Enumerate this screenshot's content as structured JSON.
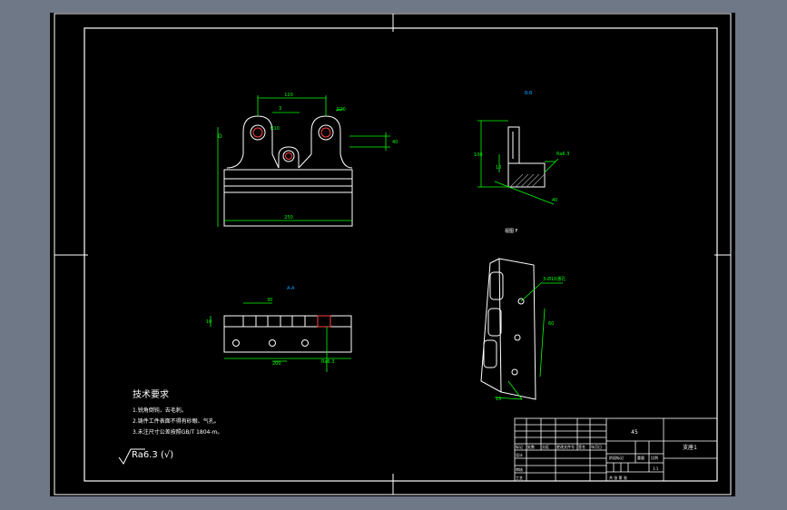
{
  "colors": {
    "viewport_bg": "#6f7887",
    "sheet_bg": "#000000",
    "frame": "#ffffff",
    "geometry": "#ffffff",
    "dimension": "#00ff00",
    "hatch": "#c0c0c0",
    "annotation": "#00a0ff",
    "highlight": "#ff4040",
    "note_text": "#ffffff"
  },
  "views": {
    "front_dims": {
      "width_top": "120",
      "width_bottom": "250",
      "hole_small": "R10",
      "hole_large": "R20",
      "tab_left": "D",
      "side": "40",
      "label_a": "3"
    },
    "section_label": "B-B",
    "section_dims": {
      "height": "100",
      "thick": "10",
      "angle_label": "Ra6.3",
      "width": "40"
    },
    "view_label_f": "视图 F",
    "bottom_label": "A-A",
    "bottom_dims": {
      "top_dim": "30",
      "right_dim": "Ra6.3",
      "bottom_dim": "200",
      "side_dim": "10"
    },
    "iso_dims": {
      "leader": "3-Ø10通孔",
      "side": "60",
      "bottom": "15"
    }
  },
  "notes": {
    "heading": "技术要求",
    "lines": [
      "1.锐角倒钝，去毛刺。",
      "2.铸件工件表面不得有砂眼、气孔。",
      "3.未注尺寸公差按照GB/T 1804-m。"
    ],
    "roughness": "Ra6.3 (√)"
  },
  "title_block": {
    "part_name": "支座1",
    "material": "45",
    "row_labels": [
      "设计",
      "审核",
      "工艺"
    ],
    "cell_labels": [
      "标记",
      "处数",
      "分区",
      "更改文件号",
      "签名",
      "年月日"
    ],
    "stage": "阶段标记",
    "weight": "重量",
    "scale": "比例",
    "sheet": "共 张 第 张",
    "scale_val": "1:1"
  }
}
